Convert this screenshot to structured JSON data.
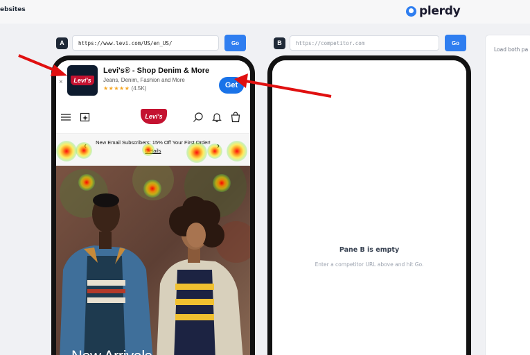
{
  "header": {
    "breadcrumb": "ebsites",
    "brand": "plerdy",
    "brand_icon": "plerdy-logo-icon"
  },
  "pane_a": {
    "badge": "A",
    "url": "https://www.levi.com/US/en_US/",
    "go_label": "Go"
  },
  "pane_b": {
    "badge": "B",
    "url_placeholder": "https://competitor.com",
    "go_label": "Go",
    "empty_title": "Pane B is empty",
    "empty_hint": "Enter a competitor URL above and hit Go."
  },
  "side_panel": {
    "text": "Load both pa"
  },
  "phone_a": {
    "app_banner": {
      "close": "×",
      "icon_text": "Levi's",
      "title": "Levi's® - Shop Denim & More",
      "subtitle": "Jeans, Denim, Fashion and More",
      "stars": "★★★★★",
      "rating_count": "(4.5K)",
      "button": "Get"
    },
    "nav": {
      "logo": "Levi's",
      "icons": [
        "menu-icon",
        "sparkle-icon",
        "search-icon",
        "bell-icon",
        "bag-icon"
      ]
    },
    "promo": {
      "text": "New Email Subscribers: 15% Off Your First Order!",
      "link": "Details",
      "prev": "‹",
      "next": "›"
    },
    "hero": {
      "title": "New Arrivals"
    }
  },
  "colors": {
    "accent": "#2f7ef0",
    "levis_red": "#c41230",
    "annotation_red": "#e01010",
    "get_button": "#1a73e8"
  }
}
